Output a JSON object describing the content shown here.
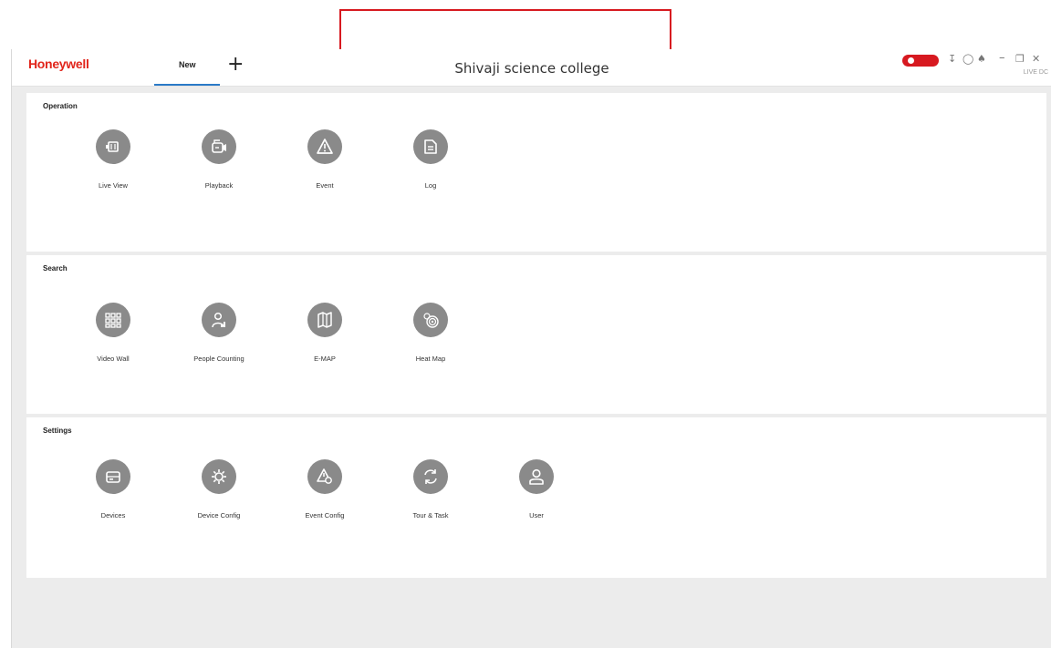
{
  "app": {
    "brand": "Honeywell",
    "title": "Shivaji science college"
  },
  "tabs": [
    {
      "label": "New",
      "active": true
    }
  ],
  "tab_add_label": "+",
  "titlebar_right": {
    "icons": [
      "alarm-toggle-icon",
      "download-icon",
      "settings-icon",
      "user-icon",
      "minimize-icon",
      "restore-icon",
      "close-icon"
    ],
    "status_text": "LIVE DC"
  },
  "sections": [
    {
      "title": "Operation",
      "items": [
        {
          "label": "Live View",
          "icon": "live-view-icon"
        },
        {
          "label": "Playback",
          "icon": "playback-icon"
        },
        {
          "label": "Event",
          "icon": "event-icon"
        },
        {
          "label": "Log",
          "icon": "log-icon"
        }
      ]
    },
    {
      "title": "Search",
      "items": [
        {
          "label": "Video Wall",
          "icon": "video-wall-icon"
        },
        {
          "label": "People Counting",
          "icon": "people-counting-icon"
        },
        {
          "label": "E-MAP",
          "icon": "emap-icon"
        },
        {
          "label": "Heat Map",
          "icon": "heat-map-icon"
        }
      ]
    },
    {
      "title": "Settings",
      "items": [
        {
          "label": "Devices",
          "icon": "devices-icon"
        },
        {
          "label": "Device Config",
          "icon": "device-config-icon"
        },
        {
          "label": "Event Config",
          "icon": "event-config-icon"
        },
        {
          "label": "Tour & Task",
          "icon": "tour-task-icon"
        },
        {
          "label": "User",
          "icon": "user-icon"
        }
      ]
    }
  ],
  "colors": {
    "brand": "#e1251b",
    "highlight_box": "#d71920",
    "tab_underline": "#2a7ac7",
    "icon_circle": "#8a8a8a",
    "background": "#ececec"
  }
}
